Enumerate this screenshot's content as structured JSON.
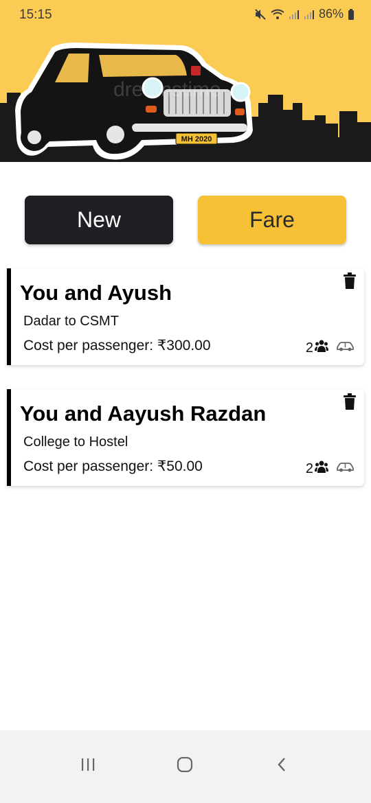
{
  "status_bar": {
    "time": "15:15",
    "battery": "86%",
    "icons": [
      "mute-icon",
      "wifi-icon",
      "signal-icon",
      "signal-icon",
      "battery-icon"
    ]
  },
  "header": {
    "plate": "MH 2020",
    "watermark": "dreamstime",
    "colors": {
      "background": "#fccb54",
      "skyline": "#1a1a1a",
      "taxi_body": "#141414"
    }
  },
  "actions": {
    "new_label": "New",
    "fare_label": "Fare"
  },
  "rides": [
    {
      "title": "You and Ayush",
      "route": "Dadar to CSMT",
      "cost": "Cost per passenger: ₹300.00",
      "passengers": "2",
      "icons": [
        "trash-icon",
        "group-icon",
        "car-icon"
      ]
    },
    {
      "title": "You and Aayush Razdan",
      "route": "College to Hostel",
      "cost": "Cost per passenger: ₹50.00",
      "passengers": "2",
      "icons": [
        "trash-icon",
        "group-icon",
        "car-icon"
      ]
    }
  ],
  "navigation": {
    "icons": [
      "recent-apps-icon",
      "home-icon",
      "back-icon"
    ]
  },
  "colors": {
    "new_button": "#1f2024",
    "fare_button": "#f6c134",
    "card_accent": "#000000"
  }
}
